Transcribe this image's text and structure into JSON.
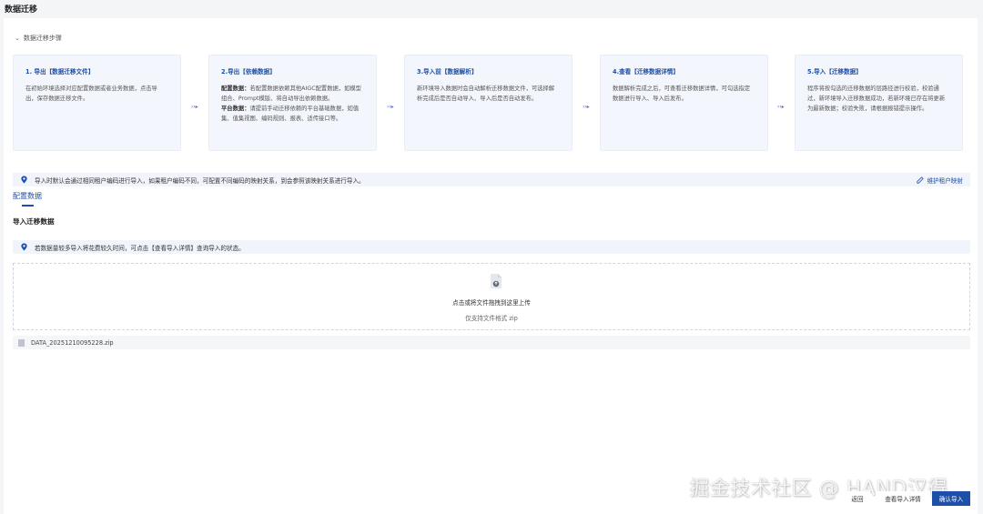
{
  "page": {
    "title": "数据迁移"
  },
  "collapse": {
    "label": "数据迁移步骤"
  },
  "steps": [
    {
      "title": "1. 导出【数据迁移文件】",
      "body": "在初始环境选择对应配置数据或者业务数据，点击导出，保存数据迁移文件。"
    },
    {
      "title": "2.导出【依赖数据】",
      "lines": [
        {
          "bold": "配置数据：",
          "text": "若配置数据依赖其他AIGC配置数据，如模型组合、Prompt模版、将自动导出依赖数据。"
        },
        {
          "bold": "平台数据：",
          "text": "请提前手动迁移依赖的平台基础数据，如值集、值集视图、编码规则、报表、适传接口等。"
        }
      ]
    },
    {
      "title": "3.导入前【数据解析】",
      "body": "新环境导入数据时会自动解析迁移数据文件，可选择解析完成后是否自动导入、导入后是否自动发布。"
    },
    {
      "title": "4.查看【迁移数据详情】",
      "body": "数据解析完成之后，可查看迁移数据详情，可勾选指定数据进行导入、导入后发布。"
    },
    {
      "title": "5.导入【迁移数据】",
      "body": "程序将按勾选的迁移数据的层路径进行校验，校验通过，新环境导入迁移数据成功，若新环境已存在将更新为最新数据；校验失败，请根据报错提示操作。"
    }
  ],
  "info1": {
    "text": "导入时默认会通过相同租户编码进行导入，如果租户编码不同，可配置不同编码的映射关系，到会参照该映射关系进行导入。",
    "link": "维护租户映射"
  },
  "tab": {
    "label": "配置数据"
  },
  "section": {
    "title": "导入迁移数据"
  },
  "info2": {
    "text": "若数据量较多导入将花费较久时间，可点击【查看导入详情】查询导入的状态。"
  },
  "upload": {
    "main": "点击或将文件拖拽到这里上传",
    "sub": "仅支持文件格式 zip"
  },
  "file": {
    "name": "DATA_20251210095228.zip"
  },
  "watermark": "掘金技术社区 @ HAND汉得",
  "footer": {
    "back": "返回",
    "detail": "查看导入详情",
    "confirm": "确认导入"
  },
  "colors": {
    "primary": "#1e4fa8",
    "stepBg": "#f3f6fc"
  }
}
